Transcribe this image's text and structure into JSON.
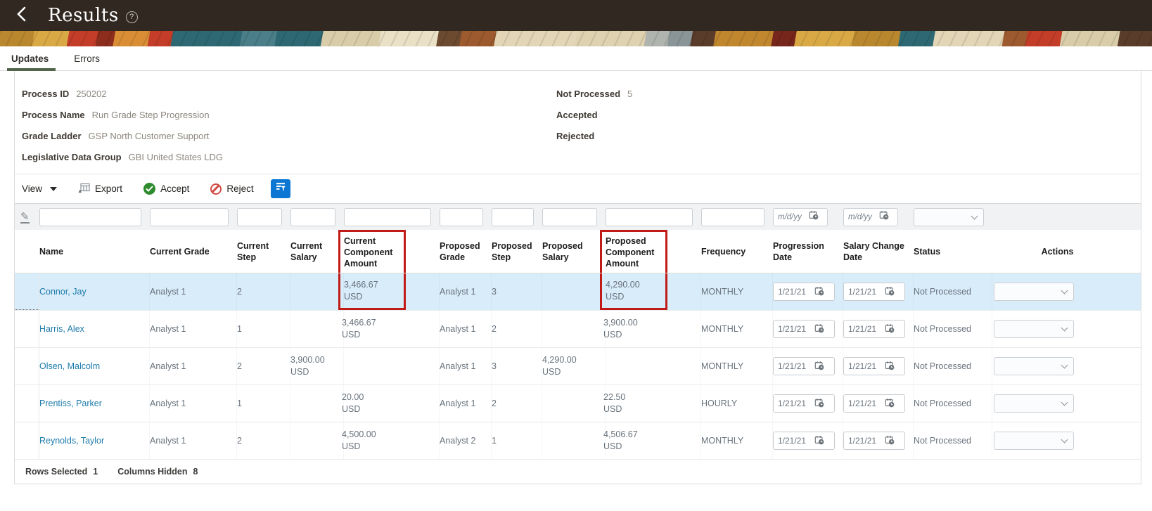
{
  "appbar": {
    "title": "Results",
    "help_glyph": "?"
  },
  "tabs": {
    "updates": "Updates",
    "errors": "Errors"
  },
  "process_info": {
    "left": [
      {
        "label": "Process ID",
        "value": "250202"
      },
      {
        "label": "Process Name",
        "value": "Run Grade Step Progression"
      },
      {
        "label": "Grade Ladder",
        "value": "GSP North Customer Support"
      },
      {
        "label": "Legislative Data Group",
        "value": "GBI United States LDG"
      }
    ],
    "right": [
      {
        "label": "Not Processed",
        "value": "5"
      },
      {
        "label": "Accepted",
        "value": ""
      },
      {
        "label": "Rejected",
        "value": ""
      }
    ]
  },
  "toolbar": {
    "view_label": "View",
    "export_label": "Export",
    "accept_label": "Accept",
    "reject_label": "Reject"
  },
  "filter_row": {
    "date_placeholder": "m/d/yy"
  },
  "icons": {
    "back": "chevron-left-icon",
    "help": "question-circle-icon",
    "export": "spreadsheet-export-icon",
    "accept": "check-circle-icon",
    "reject": "prohibited-icon",
    "qbe_filter": "table-filter-icon",
    "edit": "pencil-icon",
    "date": "calendar-clock-icon",
    "dropdown": "chevron-down-icon"
  },
  "colors": {
    "appbar_bg": "#312822",
    "tab_underline": "#53644c",
    "accent_blue": "#0b77d2",
    "selected_row": "#d9ecf9",
    "annotation_red": "#c11b17",
    "accept_green": "#2e8b2e",
    "reject_red": "#d14c44",
    "name_link": "#1d7bab"
  },
  "table": {
    "columns": [
      "Name",
      "Current Grade",
      "Current Step",
      "Current Salary",
      "Current Component Amount",
      "Proposed Grade",
      "Proposed Step",
      "Proposed Salary",
      "Proposed Component Amount",
      "Frequency",
      "Progression Date",
      "Salary Change Date",
      "Status",
      "Actions"
    ],
    "rows": [
      {
        "name": "Connor, Jay",
        "current_grade": "Analyst 1",
        "current_step": "2",
        "current_salary": "",
        "current_component_amount": "3,466.67\nUSD",
        "proposed_grade": "Analyst 1",
        "proposed_step": "3",
        "proposed_salary": "",
        "proposed_component_amount": "4,290.00\nUSD",
        "frequency": "MONTHLY",
        "progression_date": "1/21/21",
        "salary_change_date": "1/21/21",
        "status": "Not Processed",
        "selected": true,
        "annotated": true
      },
      {
        "name": "Harris, Alex",
        "current_grade": "Analyst 1",
        "current_step": "1",
        "current_salary": "",
        "current_component_amount": "3,466.67\nUSD",
        "proposed_grade": "Analyst 1",
        "proposed_step": "2",
        "proposed_salary": "",
        "proposed_component_amount": "3,900.00\nUSD",
        "frequency": "MONTHLY",
        "progression_date": "1/21/21",
        "salary_change_date": "1/21/21",
        "status": "Not Processed",
        "selected": false,
        "annotated": false
      },
      {
        "name": "Olsen, Malcolm",
        "current_grade": "Analyst 1",
        "current_step": "2",
        "current_salary": "3,900.00\nUSD",
        "current_component_amount": "",
        "proposed_grade": "Analyst 1",
        "proposed_step": "3",
        "proposed_salary": "4,290.00\nUSD",
        "proposed_component_amount": "",
        "frequency": "MONTHLY",
        "progression_date": "1/21/21",
        "salary_change_date": "1/21/21",
        "status": "Not Processed",
        "selected": false,
        "annotated": false
      },
      {
        "name": "Prentiss, Parker",
        "current_grade": "Analyst 1",
        "current_step": "1",
        "current_salary": "",
        "current_component_amount": "20.00\nUSD",
        "proposed_grade": "Analyst 1",
        "proposed_step": "2",
        "proposed_salary": "",
        "proposed_component_amount": "22.50\nUSD",
        "frequency": "HOURLY",
        "progression_date": "1/21/21",
        "salary_change_date": "1/21/21",
        "status": "Not Processed",
        "selected": false,
        "annotated": false
      },
      {
        "name": "Reynolds, Taylor",
        "current_grade": "Analyst 1",
        "current_step": "2",
        "current_salary": "",
        "current_component_amount": "4,500.00\nUSD",
        "proposed_grade": "Analyst 2",
        "proposed_step": "1",
        "proposed_salary": "",
        "proposed_component_amount": "4,506.67\nUSD",
        "frequency": "MONTHLY",
        "progression_date": "1/21/21",
        "salary_change_date": "1/21/21",
        "status": "Not Processed",
        "selected": false,
        "annotated": false
      }
    ]
  },
  "footer": {
    "rows_selected_label": "Rows Selected",
    "rows_selected": "1",
    "columns_hidden_label": "Columns Hidden",
    "columns_hidden": "8"
  }
}
